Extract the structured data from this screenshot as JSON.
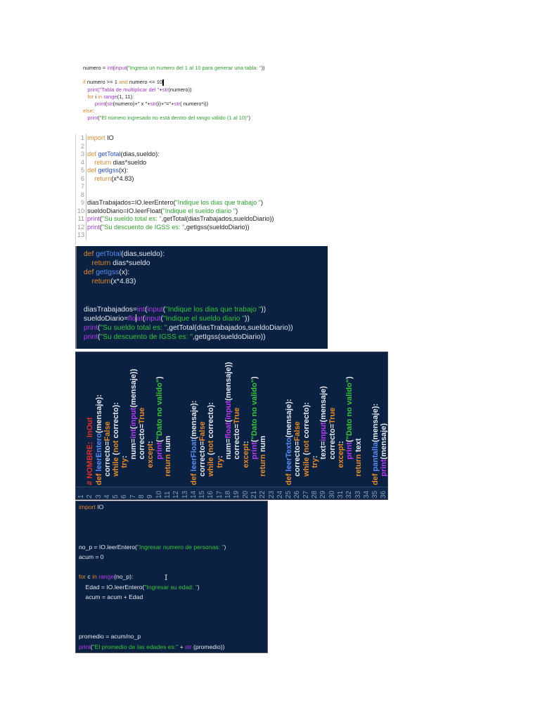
{
  "p1": {
    "numbered": false,
    "lines": [
      [
        [
          "numero = ",
          "n"
        ],
        [
          "int",
          "p"
        ],
        [
          "(",
          "n"
        ],
        [
          "input",
          "p"
        ],
        [
          "(",
          "n"
        ],
        [
          "\"Ingresa un numero del 1 al 10 para generar una tabla: \"",
          "s"
        ],
        [
          "))",
          "n"
        ]
      ],
      [],
      [
        [
          "if",
          "k"
        ],
        [
          " numero >= 1 ",
          "n"
        ],
        [
          "and",
          "k"
        ],
        [
          " numero <= 10",
          "n"
        ],
        [
          "",
          "cursor"
        ]
      ],
      [
        [
          "   ",
          "n"
        ],
        [
          "print",
          "p"
        ],
        [
          "(\"Tabla de multiplicar del \"",
          "p"
        ],
        [
          "+",
          "n"
        ],
        [
          "str",
          "p"
        ],
        [
          "(numero))",
          "n"
        ]
      ],
      [
        [
          "   ",
          "n"
        ],
        [
          "for",
          "k"
        ],
        [
          " i ",
          "n"
        ],
        [
          "in",
          "k"
        ],
        [
          " ",
          "n"
        ],
        [
          "range",
          "p"
        ],
        [
          "(1, 11):",
          "n"
        ]
      ],
      [
        [
          "        ",
          "n"
        ],
        [
          "print",
          "p"
        ],
        [
          "(",
          "n"
        ],
        [
          "str",
          "p"
        ],
        [
          "(numero)+\" x \"+",
          "n"
        ],
        [
          "str",
          "p"
        ],
        [
          "(i)+\"=\"+",
          "n"
        ],
        [
          "str",
          "p"
        ],
        [
          "( numero*i))",
          "n"
        ]
      ],
      [
        [
          "else",
          "k"
        ],
        [
          ":",
          "n"
        ]
      ],
      [
        [
          "   ",
          "n"
        ],
        [
          "print",
          "p"
        ],
        [
          "(",
          "n"
        ],
        [
          "\"El número ingresado no está dentro del rango válido (1 al 10)\"",
          "s"
        ],
        [
          ")",
          "n"
        ]
      ]
    ]
  },
  "p2": {
    "numbered": true,
    "lines": [
      [
        [
          "import",
          "k"
        ],
        [
          " IO",
          "n"
        ]
      ],
      [],
      [
        [
          "def",
          "k"
        ],
        [
          " ",
          "n"
        ],
        [
          "getTotal",
          "f"
        ],
        [
          "(dias,sueldo):",
          "n"
        ]
      ],
      [
        [
          "    ",
          "n"
        ],
        [
          "return",
          "k"
        ],
        [
          " dias*sueldo",
          "n"
        ]
      ],
      [
        [
          "def",
          "k"
        ],
        [
          " ",
          "n"
        ],
        [
          "getIgss",
          "f"
        ],
        [
          "(x):",
          "n"
        ]
      ],
      [
        [
          "    ",
          "n"
        ],
        [
          "return",
          "k"
        ],
        [
          "(x*4.83)",
          "n"
        ]
      ],
      [],
      [],
      [
        [
          "diasTrabajados=IO.leerEntero(",
          "n"
        ],
        [
          "\"Indique los dias que trabajo \"",
          "s"
        ],
        [
          ")",
          "n"
        ]
      ],
      [
        [
          "sueldoDiario=IO.leerFloat(",
          "n"
        ],
        [
          "\"Indique el sueldo diario \"",
          "s"
        ],
        [
          ")",
          "n"
        ]
      ],
      [
        [
          "print",
          "p"
        ],
        [
          "(",
          "n"
        ],
        [
          "\"Su sueldo total es: \"",
          "s"
        ],
        [
          ",getTotal(diasTrabajados,sueldoDiario))",
          "n"
        ]
      ],
      [
        [
          "print",
          "p"
        ],
        [
          "(",
          "n"
        ],
        [
          "\"Su descuento de IGSS es: \"",
          "s"
        ],
        [
          ",getIgss(sueldoDiario))",
          "n"
        ]
      ],
      []
    ]
  },
  "p3": {
    "numbered": false,
    "lines": [
      [
        [
          "def",
          "k"
        ],
        [
          " ",
          "n"
        ],
        [
          "getTotal",
          "f"
        ],
        [
          "(dias,sueldo):",
          "n"
        ]
      ],
      [
        [
          "    ",
          "n"
        ],
        [
          "return",
          "k"
        ],
        [
          " dias*sueldo",
          "n"
        ]
      ],
      [
        [
          "def",
          "k"
        ],
        [
          " ",
          "n"
        ],
        [
          "getIgss",
          "f"
        ],
        [
          "(x):",
          "n"
        ]
      ],
      [
        [
          "    ",
          "n"
        ],
        [
          "return",
          "k"
        ],
        [
          "(x*4.83)",
          "n"
        ]
      ],
      [],
      [],
      [
        [
          "diasTrabajados=",
          "n"
        ],
        [
          "int",
          "p"
        ],
        [
          "(",
          "n"
        ],
        [
          "input",
          "p"
        ],
        [
          "(",
          "n"
        ],
        [
          "\"Indique los dias que trabajo \"",
          "s"
        ],
        [
          "))",
          "n"
        ]
      ],
      [
        [
          "sueldoDiario=",
          "n"
        ],
        [
          "flo",
          "p"
        ],
        [
          "",
          "cursor"
        ],
        [
          "at",
          "p"
        ],
        [
          "(",
          "n"
        ],
        [
          "input",
          "p"
        ],
        [
          "(",
          "n"
        ],
        [
          "\"Indique el sueldo diario \"",
          "s"
        ],
        [
          "))",
          "n"
        ]
      ],
      [
        [
          "print",
          "p"
        ],
        [
          "(",
          "n"
        ],
        [
          "\"Su sueldo total es: \"",
          "s"
        ],
        [
          ",getTotal(diasTrabajados,sueldoDiario))",
          "n"
        ]
      ],
      [
        [
          "print",
          "p"
        ],
        [
          "(",
          "n"
        ],
        [
          "\"Su descuento de IGSS es: \"",
          "s"
        ],
        [
          ",getIgss(sueldoDiario))",
          "n"
        ]
      ]
    ]
  },
  "p4": {
    "numbered": true,
    "lines": [
      [],
      [
        [
          "# NOMBRE:  InOut",
          "c"
        ]
      ],
      [
        [
          "def",
          "k"
        ],
        [
          " ",
          "n"
        ],
        [
          "leerEntero",
          "f"
        ],
        [
          "(mensaje):",
          "n"
        ]
      ],
      [
        [
          "    correcto=",
          "n"
        ],
        [
          "False",
          "k"
        ]
      ],
      [
        [
          "    ",
          "n"
        ],
        [
          "while",
          "k"
        ],
        [
          " (",
          "n"
        ],
        [
          "not",
          "k"
        ],
        [
          " correcto):",
          "n"
        ]
      ],
      [
        [
          "        ",
          "n"
        ],
        [
          "try",
          "k"
        ],
        [
          ":",
          "n"
        ]
      ],
      [
        [
          "            num=",
          "n"
        ],
        [
          "int",
          "p"
        ],
        [
          "(",
          "n"
        ],
        [
          "input",
          "p"
        ],
        [
          "(mensaje))",
          "n"
        ]
      ],
      [
        [
          "            correcto=",
          "n"
        ],
        [
          "True",
          "k"
        ]
      ],
      [
        [
          "        ",
          "n"
        ],
        [
          "except",
          "k"
        ],
        [
          ":",
          "n"
        ]
      ],
      [
        [
          "            ",
          "n"
        ],
        [
          "print",
          "p"
        ],
        [
          "(",
          "n"
        ],
        [
          "\"Dato no valido\"",
          "s"
        ],
        [
          ")",
          "n"
        ]
      ],
      [
        [
          "    ",
          "n"
        ],
        [
          "return",
          "k"
        ],
        [
          " num",
          "n"
        ]
      ],
      [],
      [],
      [
        [
          "def",
          "k"
        ],
        [
          " ",
          "n"
        ],
        [
          "leerFloat",
          "f"
        ],
        [
          "(mensaje):",
          "n"
        ]
      ],
      [
        [
          "    correcto=",
          "n"
        ],
        [
          "False",
          "k"
        ]
      ],
      [
        [
          "    ",
          "n"
        ],
        [
          "while",
          "k"
        ],
        [
          " (",
          "n"
        ],
        [
          "not",
          "k"
        ],
        [
          " correcto):",
          "n"
        ]
      ],
      [
        [
          "        ",
          "n"
        ],
        [
          "try",
          "k"
        ],
        [
          ":",
          "n"
        ]
      ],
      [
        [
          "            num=",
          "n"
        ],
        [
          "float",
          "p"
        ],
        [
          "(",
          "n"
        ],
        [
          "input",
          "p"
        ],
        [
          "(mensaje))",
          "n"
        ]
      ],
      [
        [
          "            correcto=",
          "n"
        ],
        [
          "True",
          "k"
        ]
      ],
      [
        [
          "        ",
          "n"
        ],
        [
          "except",
          "k"
        ],
        [
          ":",
          "n"
        ]
      ],
      [
        [
          "            ",
          "n"
        ],
        [
          "print",
          "p"
        ],
        [
          "(",
          "n"
        ],
        [
          "\"Dato no valido\"",
          "s"
        ],
        [
          ")",
          "n"
        ]
      ],
      [
        [
          "    ",
          "n"
        ],
        [
          "return",
          "k"
        ],
        [
          " num",
          "n"
        ]
      ],
      [],
      [],
      [
        [
          "def",
          "k"
        ],
        [
          " ",
          "n"
        ],
        [
          "leerTexto",
          "f"
        ],
        [
          "(mensaje):",
          "n"
        ]
      ],
      [
        [
          "    correcto=",
          "n"
        ],
        [
          "False",
          "k"
        ]
      ],
      [
        [
          "    ",
          "n"
        ],
        [
          "while",
          "k"
        ],
        [
          " (",
          "n"
        ],
        [
          "not",
          "k"
        ],
        [
          " correcto):",
          "n"
        ]
      ],
      [
        [
          "        ",
          "n"
        ],
        [
          "try",
          "k"
        ],
        [
          ":",
          "n"
        ]
      ],
      [
        [
          "            text=",
          "n"
        ],
        [
          "input",
          "p"
        ],
        [
          "(mensaje)",
          "n"
        ]
      ],
      [
        [
          "            correcto=",
          "n"
        ],
        [
          "True",
          "k"
        ]
      ],
      [
        [
          "        ",
          "n"
        ],
        [
          "except",
          "k"
        ],
        [
          ":",
          "n"
        ]
      ],
      [
        [
          "            ",
          "n"
        ],
        [
          "print",
          "p"
        ],
        [
          "(",
          "n"
        ],
        [
          "\"Dato no valido\"",
          "s"
        ],
        [
          ")",
          "n"
        ]
      ],
      [
        [
          "    ",
          "n"
        ],
        [
          "return",
          "k"
        ],
        [
          " text",
          "n"
        ]
      ],
      [],
      [
        [
          "def",
          "k"
        ],
        [
          " ",
          "n"
        ],
        [
          "pantalla",
          "f"
        ],
        [
          "(mensaje):",
          "n"
        ]
      ],
      [
        [
          "    ",
          "n"
        ],
        [
          "print",
          "p"
        ],
        [
          "(mensaje)",
          "n"
        ]
      ],
      []
    ]
  },
  "p5": {
    "numbered": false,
    "lines": [
      [
        [
          "import",
          "k"
        ],
        [
          " IO",
          "n"
        ]
      ],
      [],
      [],
      [],
      [
        [
          "no_p = IO.leerEntero(",
          "n"
        ],
        [
          "\"Ingresar numero de personas: \"",
          "s"
        ],
        [
          ")",
          "n"
        ]
      ],
      [
        [
          "acum = 0",
          "n"
        ]
      ],
      [],
      [
        [
          "for",
          "k"
        ],
        [
          " c ",
          "n"
        ],
        [
          "in",
          "k"
        ],
        [
          " ",
          "n"
        ],
        [
          "range",
          "p"
        ],
        [
          "(no_p):",
          "n"
        ]
      ],
      [
        [
          "    Edad = IO.leerEntero(",
          "n"
        ],
        [
          "\"Ingresar su edad: \"",
          "s"
        ],
        [
          ")",
          "n"
        ]
      ],
      [
        [
          "    acum = acum + Edad",
          "n"
        ]
      ],
      [],
      [],
      [],
      [
        [
          "promedio = acum/no_p",
          "n"
        ]
      ],
      [
        [
          "print",
          "p"
        ],
        [
          "(",
          "n"
        ],
        [
          "\"El promedio de las edades es:\"",
          "s"
        ],
        [
          " + ",
          "n"
        ],
        [
          "str",
          "p"
        ],
        [
          " (promedio))",
          "n"
        ]
      ]
    ]
  },
  "colors": {
    "dark_bg": "#0b2142",
    "keyword": "#e08a2c",
    "builtin": "#b53cf0",
    "string": "#39c43a",
    "function": "#5a8cf2",
    "comment": "#e0302a"
  }
}
